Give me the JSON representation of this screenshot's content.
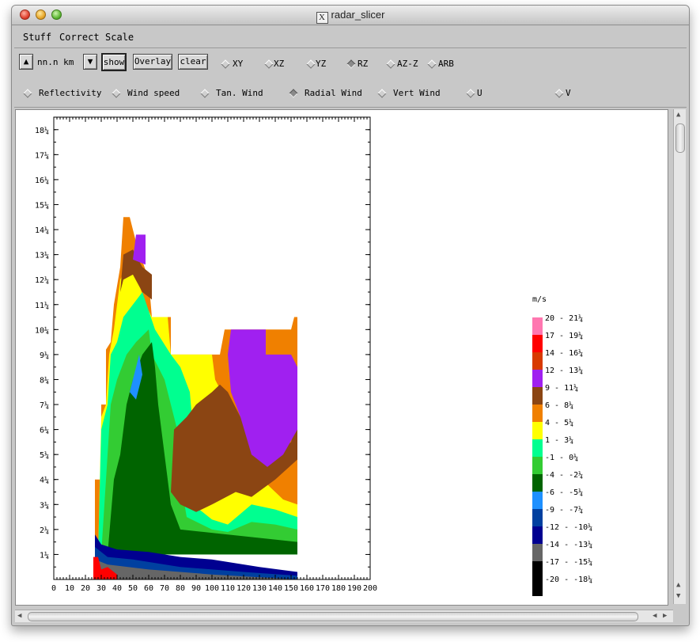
{
  "window": {
    "title": "radar_slicer",
    "title_icon": "X"
  },
  "menu": [
    "Stuff",
    "Correct",
    "Scale"
  ],
  "toolbar": {
    "height_value": "nn.n km",
    "up_icon": "up-triangle-icon",
    "down_icon": "down-triangle-icon",
    "show_label": "show",
    "overlay_label": "Overlay",
    "clear_label": "clear",
    "planes": [
      {
        "label": "XY",
        "selected": false
      },
      {
        "label": "XZ",
        "selected": false
      },
      {
        "label": "YZ",
        "selected": false
      },
      {
        "label": "RZ",
        "selected": true
      },
      {
        "label": "AZ-Z",
        "selected": false
      },
      {
        "label": "ARB",
        "selected": false
      }
    ]
  },
  "fields": [
    {
      "label": "Reflectivity",
      "selected": false
    },
    {
      "label": "Wind speed",
      "selected": false
    },
    {
      "label": "Tan. Wind",
      "selected": false
    },
    {
      "label": "Radial Wind",
      "selected": true
    },
    {
      "label": "Vert Wind",
      "selected": false
    },
    {
      "label": "U",
      "selected": false
    },
    {
      "label": "V",
      "selected": false
    }
  ],
  "plot": {
    "x_ticks": [
      "0",
      "10",
      "20",
      "30",
      "40",
      "50",
      "60",
      "70",
      "80",
      "90",
      "100",
      "110",
      "120",
      "130",
      "140",
      "150",
      "160",
      "170",
      "180",
      "190",
      "200"
    ],
    "y_ticks": [
      "1¼",
      "2¼",
      "3¼",
      "4¼",
      "5¼",
      "6¼",
      "7¼",
      "8¼",
      "9¼",
      "10¼",
      "11¼",
      "12¼",
      "13¼",
      "14¼",
      "15¼",
      "16¼",
      "17¼",
      "18¼"
    ],
    "x_range": [
      0,
      200
    ],
    "y_range": [
      0,
      18.5
    ]
  },
  "legend": {
    "unit": "m/s",
    "entries": [
      {
        "label": "20 - 21¼",
        "color": "#ff77b0"
      },
      {
        "label": "17 - 19¼",
        "color": "#ff0000"
      },
      {
        "label": "14 - 16¼",
        "color": "#d83a00"
      },
      {
        "label": "12 - 13¼",
        "color": "#a020f0"
      },
      {
        "label": "9 - 11¼",
        "color": "#8b4513"
      },
      {
        "label": "6 - 8¼",
        "color": "#f08000"
      },
      {
        "label": "4 - 5¼",
        "color": "#ffff00"
      },
      {
        "label": "1 - 3¼",
        "color": "#00ff90"
      },
      {
        "label": "-1 - 0¼",
        "color": "#33cc33"
      },
      {
        "label": "-4 - -2¼",
        "color": "#006400"
      },
      {
        "label": "-6 - -5¼",
        "color": "#1e90ff"
      },
      {
        "label": "-9 - -7¼",
        "color": "#0040a0"
      },
      {
        "label": "-12 - -10¼",
        "color": "#000090"
      },
      {
        "label": "-14 - -13¼",
        "color": "#666666"
      },
      {
        "label": "-17 - -15¼",
        "color": "#000000"
      },
      {
        "label": "-20 - -18¼",
        "color": ""
      }
    ]
  }
}
